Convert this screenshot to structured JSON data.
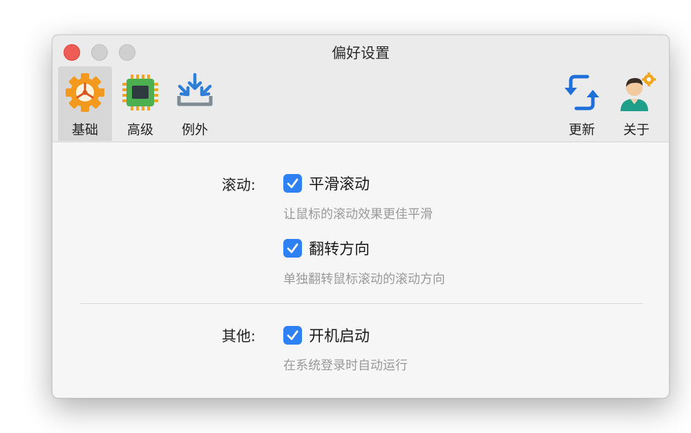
{
  "window": {
    "title": "偏好设置"
  },
  "toolbar": {
    "left_items": [
      {
        "label": "基础",
        "icon": "gear-icon"
      },
      {
        "label": "高级",
        "icon": "chip-icon"
      },
      {
        "label": "例外",
        "icon": "inbox-arrows-icon"
      }
    ],
    "right_items": [
      {
        "label": "更新",
        "icon": "refresh-icon"
      },
      {
        "label": "关于",
        "icon": "person-gear-icon"
      }
    ],
    "selected": "基础"
  },
  "sections": {
    "scrolling": {
      "label": "滚动:",
      "options": [
        {
          "label": "平滑滚动",
          "checked": true,
          "description": "让鼠标的滚动效果更佳平滑"
        },
        {
          "label": "翻转方向",
          "checked": true,
          "description": "单独翻转鼠标滚动的滚动方向"
        }
      ]
    },
    "other": {
      "label": "其他:",
      "options": [
        {
          "label": "开机启动",
          "checked": true,
          "description": "在系统登录时自动运行"
        }
      ]
    }
  },
  "colors": {
    "accent": "#2f80f2",
    "gear": "#f39a1e",
    "chip": "#4caf50",
    "close_button": "#ee5c56"
  }
}
